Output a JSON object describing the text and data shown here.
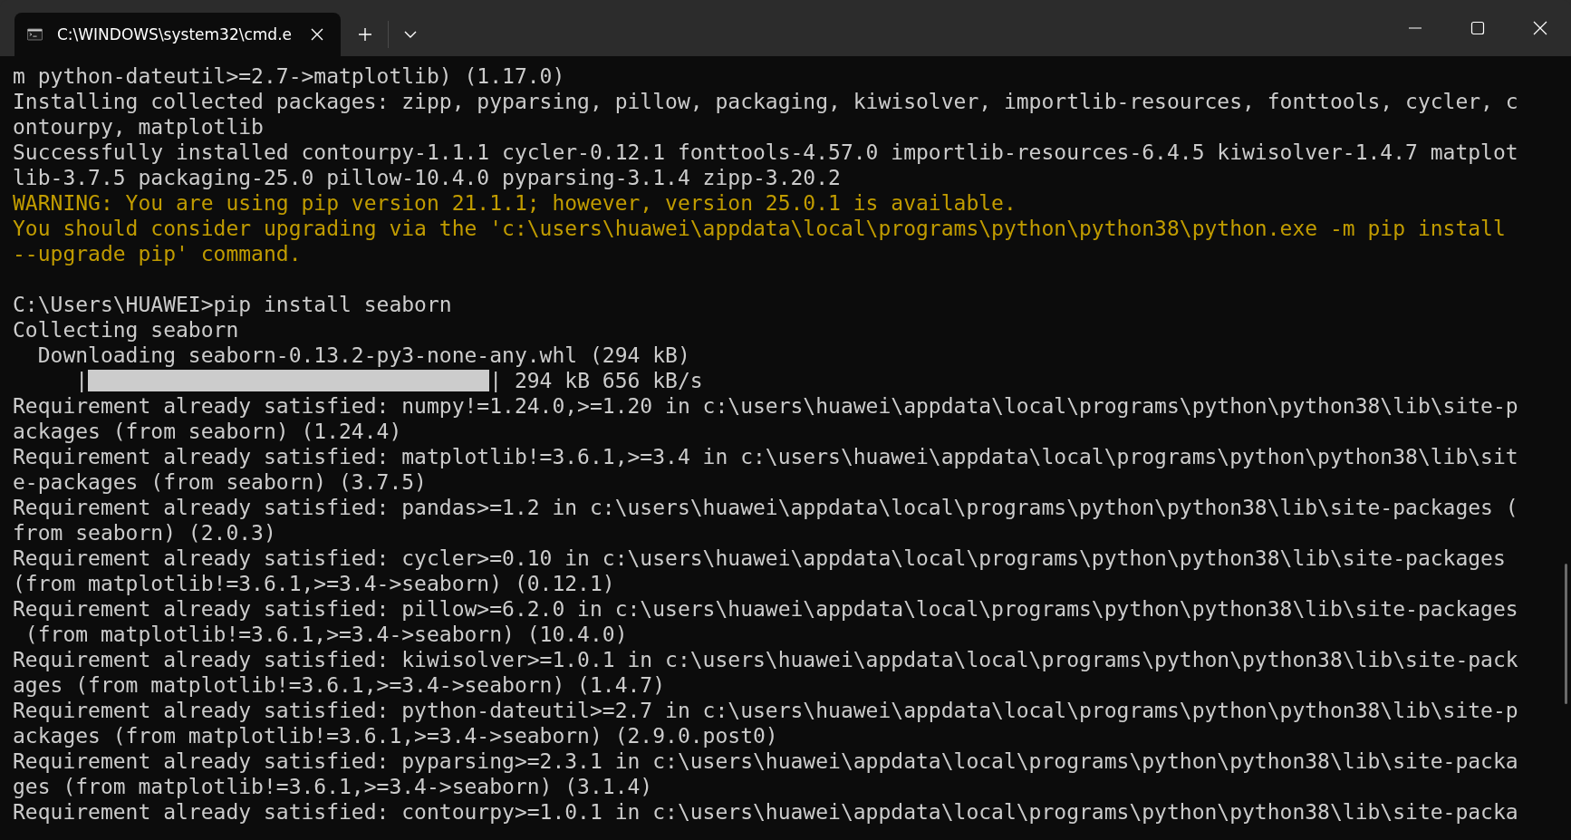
{
  "tabs": [
    {
      "title": "C:\\WINDOWS\\system32\\cmd.e",
      "selected": true
    }
  ],
  "lines": [
    {
      "kind": "output",
      "text": "m python-dateutil>=2.7->matplotlib) (1.17.0)"
    },
    {
      "kind": "output",
      "text": "Installing collected packages: zipp, pyparsing, pillow, packaging, kiwisolver, importlib-resources, fonttools, cycler, c"
    },
    {
      "kind": "output",
      "text": "ontourpy, matplotlib"
    },
    {
      "kind": "output",
      "text": "Successfully installed contourpy-1.1.1 cycler-0.12.1 fonttools-4.57.0 importlib-resources-6.4.5 kiwisolver-1.4.7 matplot"
    },
    {
      "kind": "output",
      "text": "lib-3.7.5 packaging-25.0 pillow-10.4.0 pyparsing-3.1.4 zipp-3.20.2"
    },
    {
      "kind": "warning",
      "text": "WARNING: You are using pip version 21.1.1; however, version 25.0.1 is available."
    },
    {
      "kind": "warning",
      "text": "You should consider upgrading via the 'c:\\users\\huawei\\appdata\\local\\programs\\python\\python38\\python.exe -m pip install"
    },
    {
      "kind": "warning",
      "text": "--upgrade pip' command."
    },
    {
      "kind": "blank"
    },
    {
      "kind": "output",
      "text": "C:\\Users\\HUAWEI>pip install seaborn"
    },
    {
      "kind": "output",
      "text": "Collecting seaborn"
    },
    {
      "kind": "output",
      "text": "  Downloading seaborn-0.13.2-py3-none-any.whl (294 kB)"
    },
    {
      "kind": "progress",
      "prefix": "|",
      "level": 1,
      "suffix": "| 294 kB 656 kB/s"
    },
    {
      "kind": "output",
      "text": "Requirement already satisfied: numpy!=1.24.0,>=1.20 in c:\\users\\huawei\\appdata\\local\\programs\\python\\python38\\lib\\site-p"
    },
    {
      "kind": "output",
      "text": "ackages (from seaborn) (1.24.4)"
    },
    {
      "kind": "output",
      "text": "Requirement already satisfied: matplotlib!=3.6.1,>=3.4 in c:\\users\\huawei\\appdata\\local\\programs\\python\\python38\\lib\\sit"
    },
    {
      "kind": "output",
      "text": "e-packages (from seaborn) (3.7.5)"
    },
    {
      "kind": "output",
      "text": "Requirement already satisfied: pandas>=1.2 in c:\\users\\huawei\\appdata\\local\\programs\\python\\python38\\lib\\site-packages ("
    },
    {
      "kind": "output",
      "text": "from seaborn) (2.0.3)"
    },
    {
      "kind": "output",
      "text": "Requirement already satisfied: cycler>=0.10 in c:\\users\\huawei\\appdata\\local\\programs\\python\\python38\\lib\\site-packages"
    },
    {
      "kind": "output",
      "text": "(from matplotlib!=3.6.1,>=3.4->seaborn) (0.12.1)"
    },
    {
      "kind": "output",
      "text": "Requirement already satisfied: pillow>=6.2.0 in c:\\users\\huawei\\appdata\\local\\programs\\python\\python38\\lib\\site-packages"
    },
    {
      "kind": "output",
      "text": " (from matplotlib!=3.6.1,>=3.4->seaborn) (10.4.0)"
    },
    {
      "kind": "output",
      "text": "Requirement already satisfied: kiwisolver>=1.0.1 in c:\\users\\huawei\\appdata\\local\\programs\\python\\python38\\lib\\site-pack"
    },
    {
      "kind": "output",
      "text": "ages (from matplotlib!=3.6.1,>=3.4->seaborn) (1.4.7)"
    },
    {
      "kind": "output",
      "text": "Requirement already satisfied: python-dateutil>=2.7 in c:\\users\\huawei\\appdata\\local\\programs\\python\\python38\\lib\\site-p"
    },
    {
      "kind": "output",
      "text": "ackages (from matplotlib!=3.6.1,>=3.4->seaborn) (2.9.0.post0)"
    },
    {
      "kind": "output",
      "text": "Requirement already satisfied: pyparsing>=2.3.1 in c:\\users\\huawei\\appdata\\local\\programs\\python\\python38\\lib\\site-packa"
    },
    {
      "kind": "output",
      "text": "ges (from matplotlib!=3.6.1,>=3.4->seaborn) (3.1.4)"
    },
    {
      "kind": "output",
      "text": "Requirement already satisfied: contourpy>=1.0.1 in c:\\users\\huawei\\appdata\\local\\programs\\python\\python38\\lib\\site-packa"
    }
  ]
}
